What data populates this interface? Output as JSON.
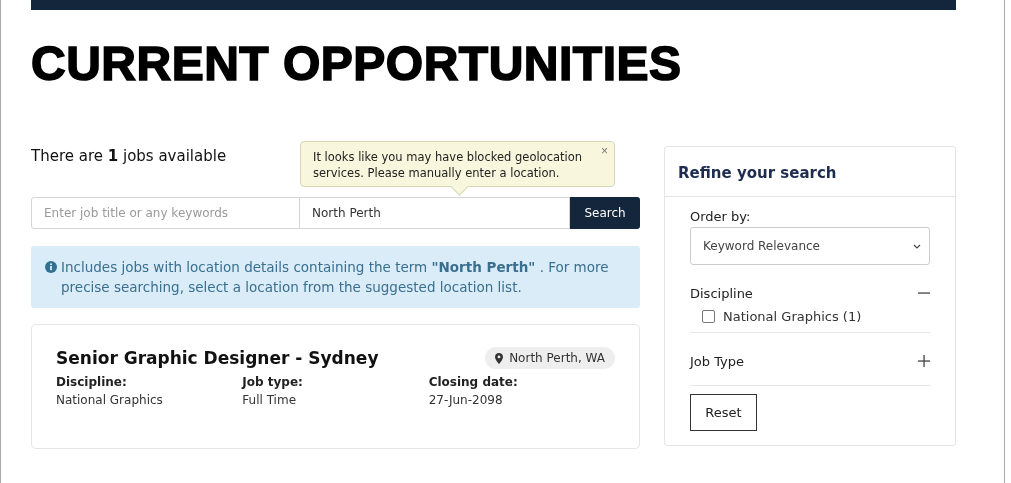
{
  "heading": "CURRENT OPPORTUNITIES",
  "job_count_text": "There are **1** jobs available",
  "tooltip": {
    "text": "It looks like you may have blocked geolocation services. Please manually enter a location.",
    "close": "×"
  },
  "search": {
    "keywords_placeholder": "Enter job title or any keywords",
    "location_value": "North Perth",
    "button": "Search"
  },
  "info_notice": "Includes jobs with location details containing the term **\"North Perth\"** . For more precise searching, select a location from the suggested location list.",
  "jobs": [
    {
      "title": "Senior Graphic Designer - Sydney",
      "location": "North Perth, WA",
      "fields": [
        {
          "label": "Discipline:",
          "value": "National Graphics"
        },
        {
          "label": "Job type:",
          "value": "Full Time"
        },
        {
          "label": "Closing date:",
          "value": "27-Jun-2098"
        }
      ]
    }
  ],
  "sidebar": {
    "title": "Refine your search",
    "order_label": "Order by:",
    "order_value": "Keyword Relevance",
    "filters": [
      {
        "label": "Discipline",
        "expanded": true,
        "options": [
          {
            "label": "National Graphics (1)",
            "checked": false
          }
        ]
      },
      {
        "label": "Job Type",
        "expanded": false
      }
    ],
    "reset": "Reset"
  }
}
